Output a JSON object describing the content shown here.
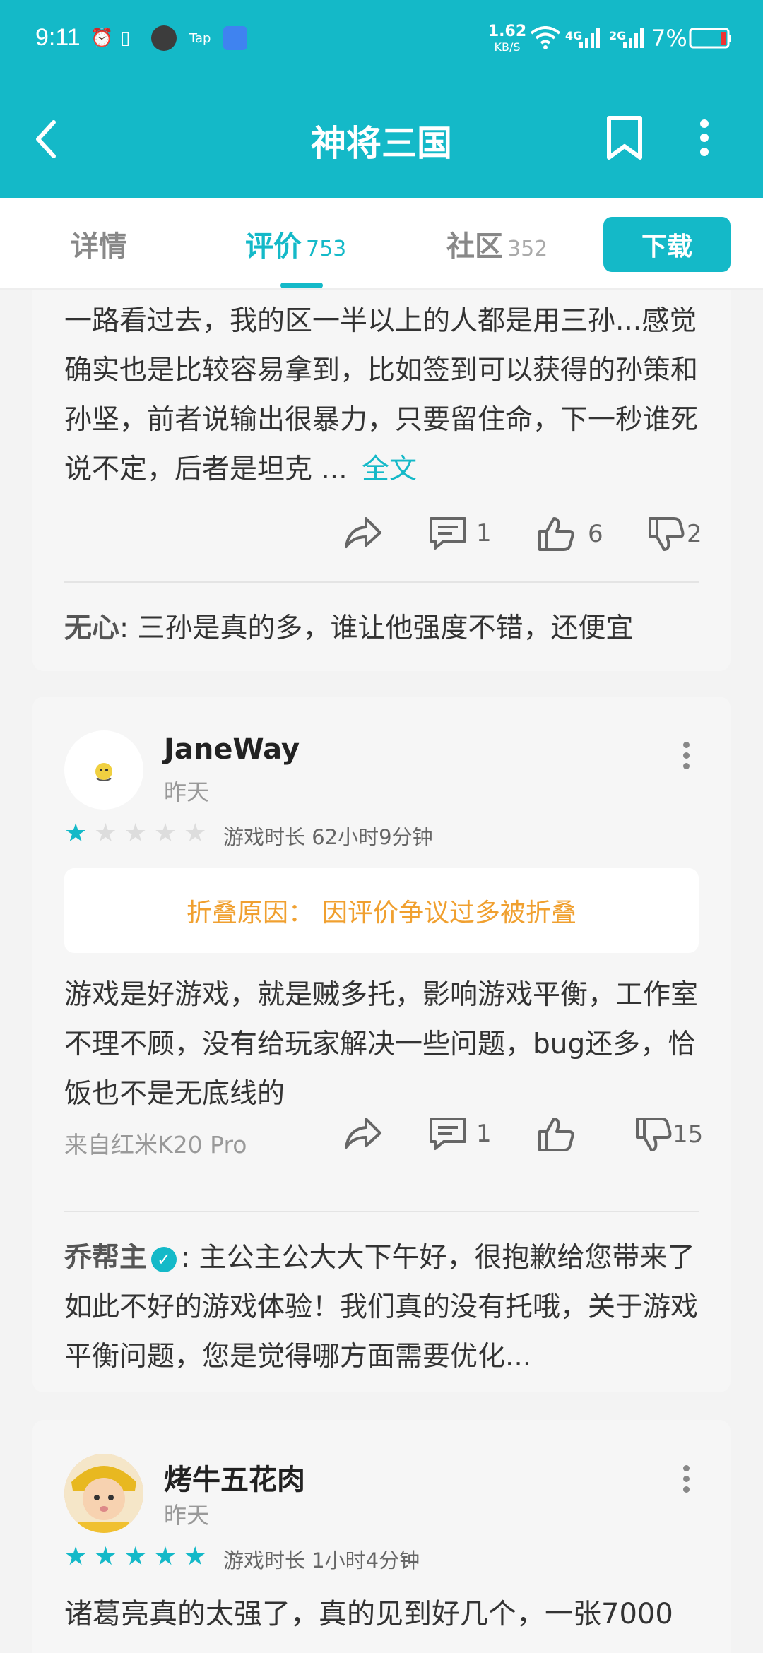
{
  "status_bar": {
    "time": "9:11",
    "speed_value": "1.62",
    "speed_unit": "KB/S",
    "net1": "4G",
    "net2": "2G",
    "battery": "7%",
    "tap_label": "Tap"
  },
  "header": {
    "title": "神将三国"
  },
  "tabs": [
    {
      "label": "详情",
      "count": ""
    },
    {
      "label": "评价",
      "count": "753"
    },
    {
      "label": "社区",
      "count": "352"
    }
  ],
  "download_label": "下载",
  "review1": {
    "text": "一路看过去，我的区一半以上的人都是用三孙...感觉确实也是比较容易拿到，比如签到可以获得的孙策和孙坚，前者说输出很暴力，只要留住命，下一秒谁死说不定，后者是坦克 ...",
    "full_link": "全文",
    "comments": "1",
    "likes": "6",
    "dislikes": "2",
    "reply_author": "无心",
    "reply_text": ": 三孙是真的多，谁让他强度不错，还便宜"
  },
  "review2": {
    "username": "JaneWay",
    "date": "昨天",
    "rating": 1,
    "playtime": "游戏时长 62小时9分钟",
    "fold_label": "折叠原因：",
    "fold_reason": "因评价争议过多被折叠",
    "text": "游戏是好游戏，就是贼多托，影响游戏平衡，工作室不理不顾，没有给玩家解决一些问题，bug还多，恰饭也不是无底线的",
    "device": "来自红米K20 Pro",
    "comments": "1",
    "likes": "",
    "dislikes": "15",
    "reply_author": "乔帮主",
    "reply_text": ": 主公主公大大下午好，很抱歉给您带来了如此不好的游戏体验！我们真的没有托哦，关于游戏平衡问题，您是觉得哪方面需要优化..."
  },
  "review3": {
    "username": "烤牛五花肉",
    "date": "昨天",
    "rating": 5,
    "playtime": "游戏时长 1小时4分钟",
    "text": "诸葛亮真的太强了，真的见到好几个，一张7000"
  },
  "colors": {
    "accent": "#14b9c8",
    "fold": "#f0a030",
    "star_off": "#dddddd"
  }
}
